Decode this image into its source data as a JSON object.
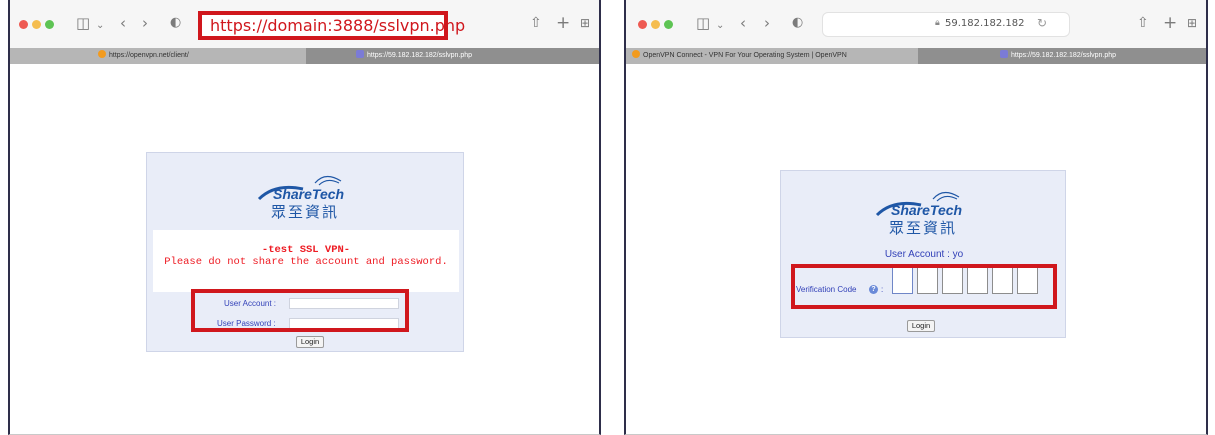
{
  "left_window": {
    "address_url": "https://domain:3888/sslvpn.php",
    "tabs": [
      {
        "title": "https://openvpn.net/client/",
        "active": false
      },
      {
        "title": "https://59.182.182.182/sslvpn.php",
        "active": true
      }
    ],
    "login": {
      "brand": "ShareTech",
      "brand_cjk": "眾至資訊",
      "message_line1": "-test SSL VPN-",
      "message_line2": "Please do not share the account and password.",
      "user_account_label": "User Account :",
      "user_password_label": "User Password :",
      "user_account_value": "",
      "user_password_value": "",
      "login_button": "Login"
    }
  },
  "right_window": {
    "address_host": "59.182.182.182",
    "tabs": [
      {
        "title": "OpenVPN Connect - VPN For Your Operating System | OpenVPN",
        "active": false
      },
      {
        "title": "https://59.182.182.182/sslvpn.php",
        "active": true
      }
    ],
    "verify": {
      "brand": "ShareTech",
      "brand_cjk": "眾至資訊",
      "user_account_text": "User Account : yo",
      "verification_label": "Verification Code",
      "help_icon": "?",
      "colon": ":",
      "code_boxes": [
        "",
        "",
        "",
        "",
        "",
        ""
      ],
      "login_button": "Login"
    }
  },
  "colors": {
    "highlight": "#d0171d",
    "panel_bg": "#e9edf8",
    "label_blue": "#3241b8",
    "warning_red": "#ee1c24"
  },
  "icons": [
    "sidebar-icon",
    "chevron-down-icon",
    "back-icon",
    "forward-icon",
    "shield-icon",
    "share-icon",
    "new-tab-icon",
    "tab-overview-icon",
    "lock-icon",
    "reload-icon"
  ]
}
